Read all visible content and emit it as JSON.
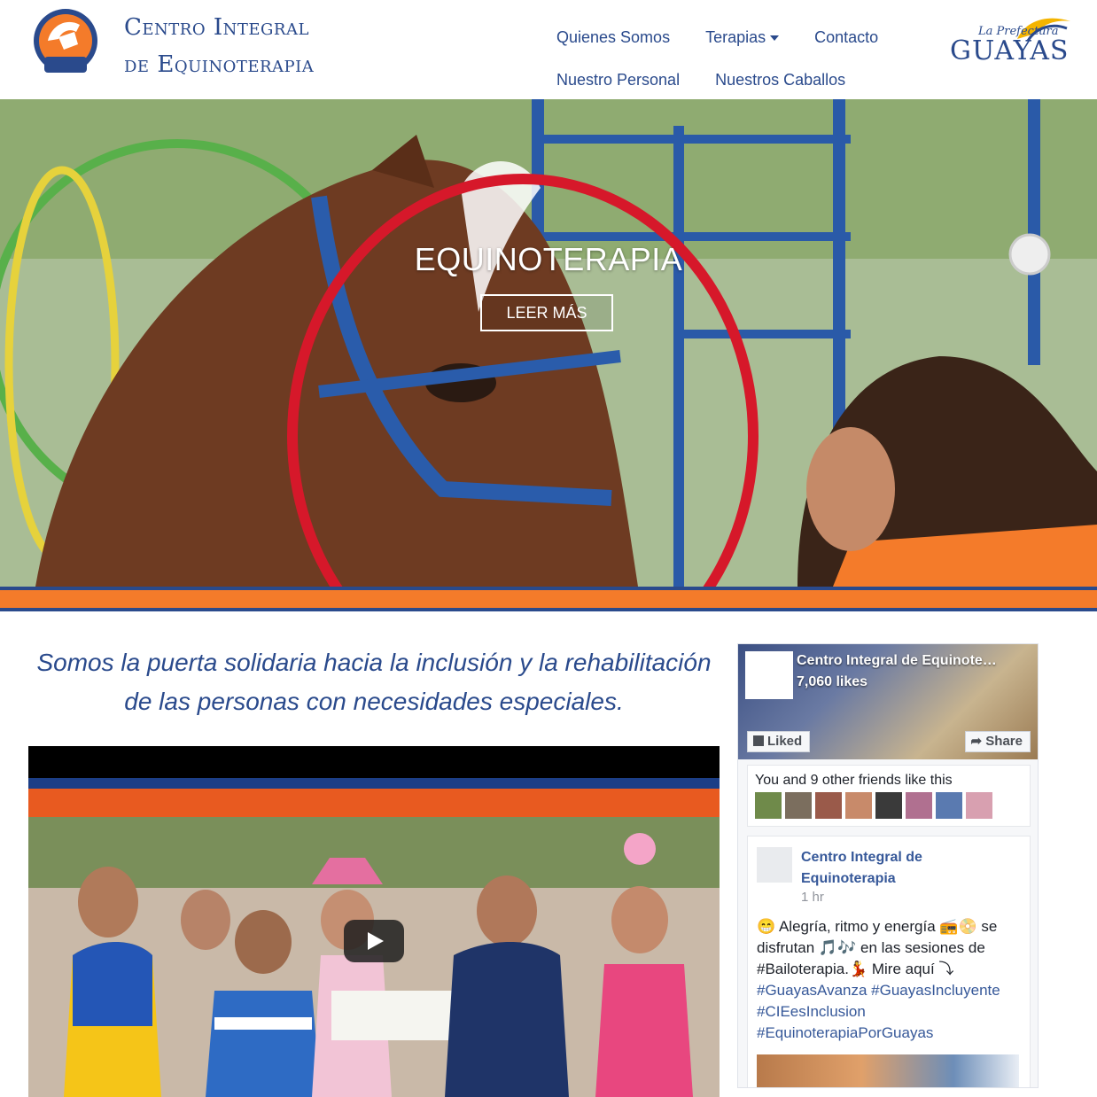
{
  "header": {
    "brand_line1": "Centro Integral",
    "brand_line2": "de Equinoterapia",
    "logo_text": "Centro Integral Equinoterapia",
    "nav": {
      "quienes": "Quienes Somos",
      "terapias": "Terapias",
      "contacto": "Contacto",
      "personal": "Nuestro Personal",
      "caballos": "Nuestros Caballos"
    },
    "partner_small": "La Prefectura",
    "partner_big": "GUAYAS"
  },
  "hero": {
    "title": "EQUINOTERAPIA",
    "button": "LEER MÁS"
  },
  "colors": {
    "brand_blue": "#2a4a8c",
    "accent_orange": "#f47b2a"
  },
  "tagline": "Somos la puerta solidaria hacia la inclusión y la rehabilitación de las personas con necesidades especiales.",
  "facebook": {
    "page_name": "Centro Integral de Equinote…",
    "likes": "7,060 likes",
    "liked_btn": "Liked",
    "share_btn": "Share",
    "friends_text": "You and 9 other friends like this",
    "post": {
      "author": "Centro Integral de Equinoterapia",
      "time": "1 hr",
      "text": "😁 Alegría, ritmo y energía 📻📀 se disfrutan 🎵🎶 en las sesiones de #Bailoterapia.💃 Mire aquí ⤵",
      "hashtags": "#GuayasAvanza #GuayasIncluyente #CIEesInclusion #EquinoterapiaPorGuayas"
    }
  }
}
